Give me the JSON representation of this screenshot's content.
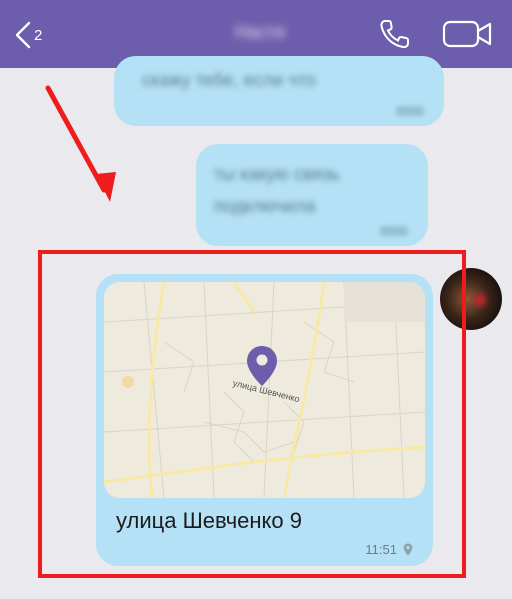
{
  "header": {
    "back_count": "2",
    "contact_name": "Настя",
    "bg_color": "#6d5ead"
  },
  "messages": [
    {
      "text": "скажу тебе, если что"
    },
    {
      "lines": [
        "ты какую связь",
        "подключила"
      ]
    }
  ],
  "location_message": {
    "map_street_label": "улица Шевченко",
    "address": "улица Шевченко 9",
    "time": "11:51",
    "bubble_color": "#b4e1f5"
  },
  "annotation": {
    "frame_color": "#ee1c1c"
  },
  "icons": [
    "chevron-left-icon",
    "phone-icon",
    "video-camera-icon",
    "map-pin-icon",
    "location-icon",
    "arrow-icon"
  ]
}
